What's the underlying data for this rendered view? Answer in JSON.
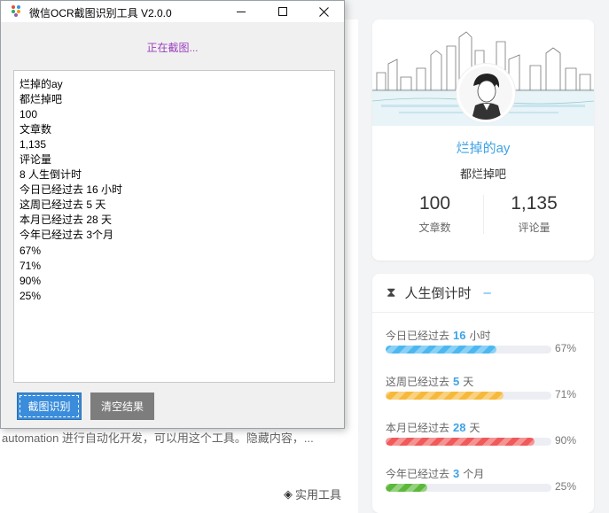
{
  "window": {
    "title": "微信OCR截图识别工具 V2.0.0",
    "status": "正在截图...",
    "results": [
      "烂掉的ay",
      "都烂掉吧",
      "100",
      "文章数",
      "1,135",
      "评论量",
      "8 人生倒计时",
      "今日已经过去 16 小时",
      "这周已经过去 5 天",
      "本月已经过去 28 天",
      "今年已经过去 3个月",
      "67%",
      "71%",
      "90%",
      "25%"
    ],
    "capture_button": "截图识别",
    "clear_button": "清空结果"
  },
  "background": {
    "excerpt": "automation 进行自动化开发，可以用这个工具。隐藏内容，...",
    "category": "实用工具",
    "profile": {
      "name": "烂掉的ay",
      "motto": "都烂掉吧",
      "articles_count": "100",
      "articles_label": "文章数",
      "comments_count": "1,135",
      "comments_label": "评论量"
    },
    "countdown": {
      "title": "人生倒计时",
      "rows": [
        {
          "prefix": "今日已经过去",
          "value": "16",
          "unit": "小时",
          "percent_text": "67%",
          "fraction": 0.67,
          "color": "#4db8f0"
        },
        {
          "prefix": "这周已经过去",
          "value": "5",
          "unit": "天",
          "percent_text": "71%",
          "fraction": 0.71,
          "color": "#f6b93b"
        },
        {
          "prefix": "本月已经过去",
          "value": "28",
          "unit": "天",
          "percent_text": "90%",
          "fraction": 0.9,
          "color": "#f05a5a"
        },
        {
          "prefix": "今年已经过去",
          "value": "3",
          "unit": "个月",
          "percent_text": "25%",
          "fraction": 0.25,
          "color": "#5cb83a"
        }
      ]
    }
  }
}
